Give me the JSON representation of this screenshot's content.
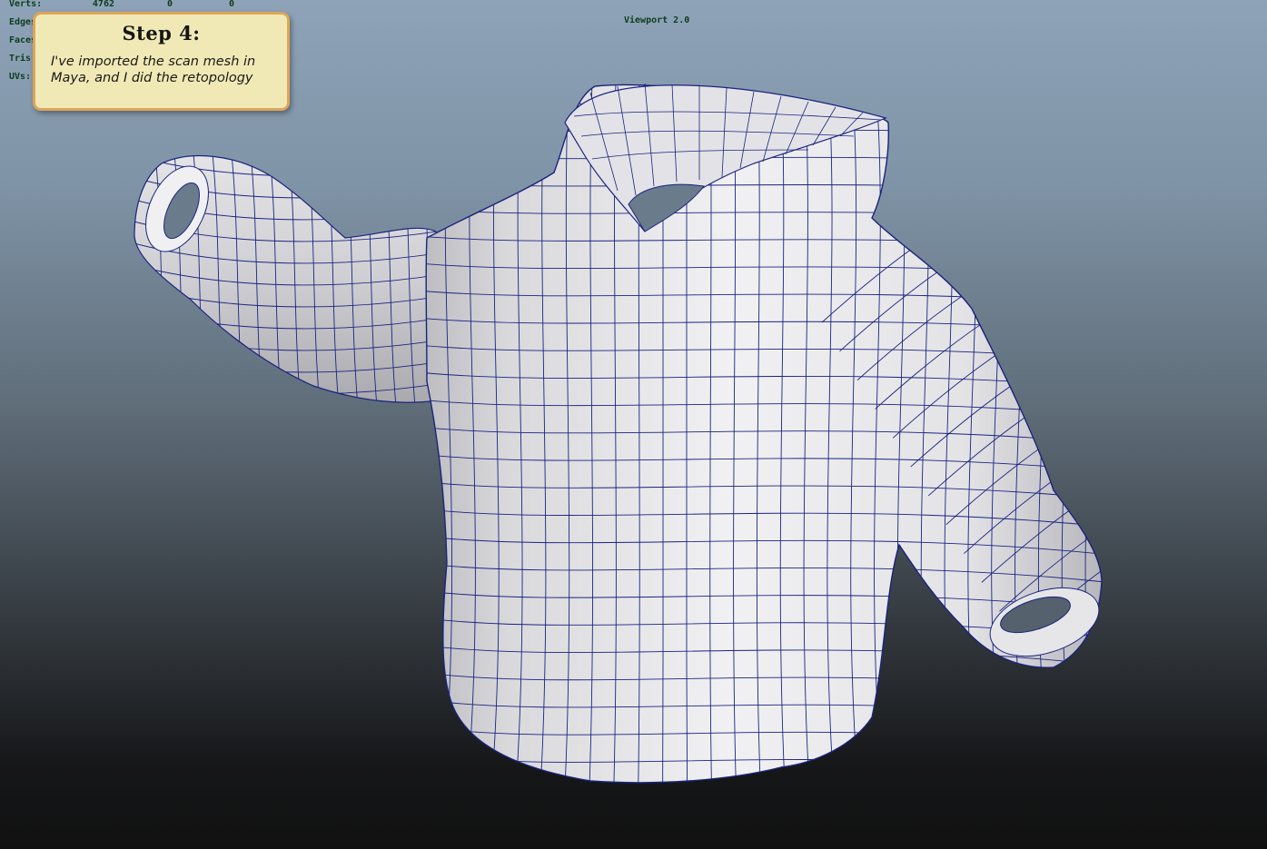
{
  "viewport": {
    "renderer_label": "Viewport 2.0"
  },
  "hud": {
    "rows": [
      {
        "label": "Verts:",
        "v0": "4762",
        "v1": "0",
        "v2": "0"
      },
      {
        "label": "Edges:",
        "v0": "",
        "v1": "",
        "v2": ""
      },
      {
        "label": "Faces:",
        "v0": "",
        "v1": "",
        "v2": ""
      },
      {
        "label": "Tris:",
        "v0": "",
        "v1": "",
        "v2": ""
      },
      {
        "label": "UVs:",
        "v0": "",
        "v1": "",
        "v2": ""
      }
    ]
  },
  "callout": {
    "title": "Step 4:",
    "line1": "I've imported the scan mesh in",
    "line2": "Maya, and I did the retopology"
  },
  "colors": {
    "wireframe": "#1a237e",
    "mesh_fill": "#e9e9ec",
    "hud_text": "#0d3d1d",
    "callout_bg": "#f1e9b5",
    "callout_border": "#dca659"
  }
}
